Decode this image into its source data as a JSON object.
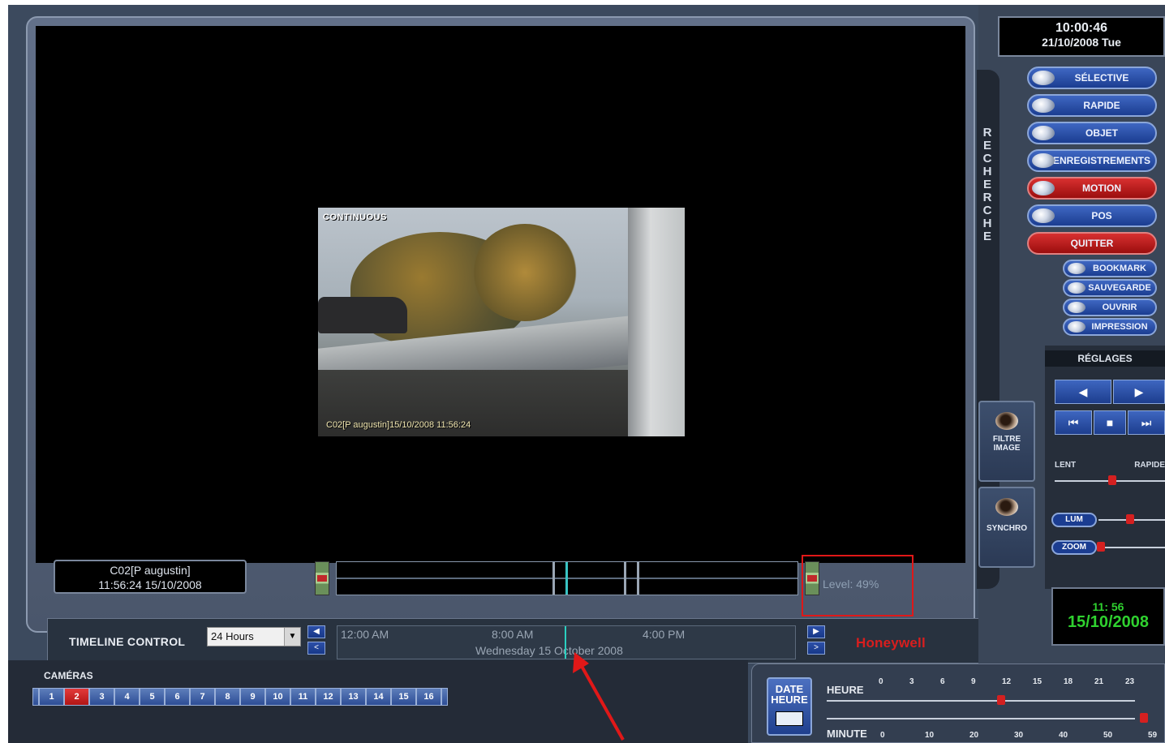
{
  "player": {
    "thumb_tag": "CONTINUOUS",
    "thumb_caption": "C02[P augustin]15/10/2008 11:56:24",
    "cam_info_line1": "C02[P augustin]",
    "cam_info_line2": "11:56:24  15/10/2008",
    "level_label": "Level: 49%"
  },
  "timeline": {
    "label": "TIMELINE CONTROL",
    "range_value": "24 Hours",
    "times": [
      "12:00 AM",
      "8:00 AM",
      "4:00 PM"
    ],
    "date": "Wednesday 15 October 2008"
  },
  "brand": "Honeywell",
  "cameras": {
    "title": "CAMÉRAS",
    "buttons": [
      "1",
      "2",
      "3",
      "4",
      "5",
      "6",
      "7",
      "8",
      "9",
      "10",
      "11",
      "12",
      "13",
      "14",
      "15",
      "16"
    ],
    "active": "2"
  },
  "clock": {
    "time": "10:00:46",
    "date": "21/10/2008 Tue"
  },
  "search": {
    "title_letters": [
      "R",
      "E",
      "C",
      "H",
      "E",
      "R",
      "C",
      "H",
      "E"
    ],
    "buttons": [
      "SÉLECTIVE",
      "RAPIDE",
      "OBJET",
      "ENREGISTREMENTS",
      "MOTION",
      "POS"
    ],
    "quit": "QUITTER",
    "small": [
      "BOOKMARK",
      "SAUVEGARDE",
      "OUVRIR",
      "IMPRESSION"
    ]
  },
  "reglages": {
    "title": "RÉGLAGES",
    "slow": "LENT",
    "fast": "RAPIDE",
    "lum": "LUM",
    "zoom": "ZOOM"
  },
  "side_buttons": {
    "filter_line1": "FILTRE",
    "filter_line2": "IMAGE",
    "sync": "SYNCHRO"
  },
  "current": {
    "time": "11: 56",
    "date": "15/10/2008"
  },
  "date_panel": {
    "btn_line1": "DATE",
    "btn_line2": "HEURE",
    "heure_label": "HEURE",
    "minute_label": "MINUTE",
    "hour_ticks": [
      "0",
      "3",
      "6",
      "9",
      "12",
      "15",
      "18",
      "21",
      "23"
    ],
    "minute_ticks": [
      "0",
      "10",
      "20",
      "30",
      "40",
      "50",
      "59"
    ]
  }
}
